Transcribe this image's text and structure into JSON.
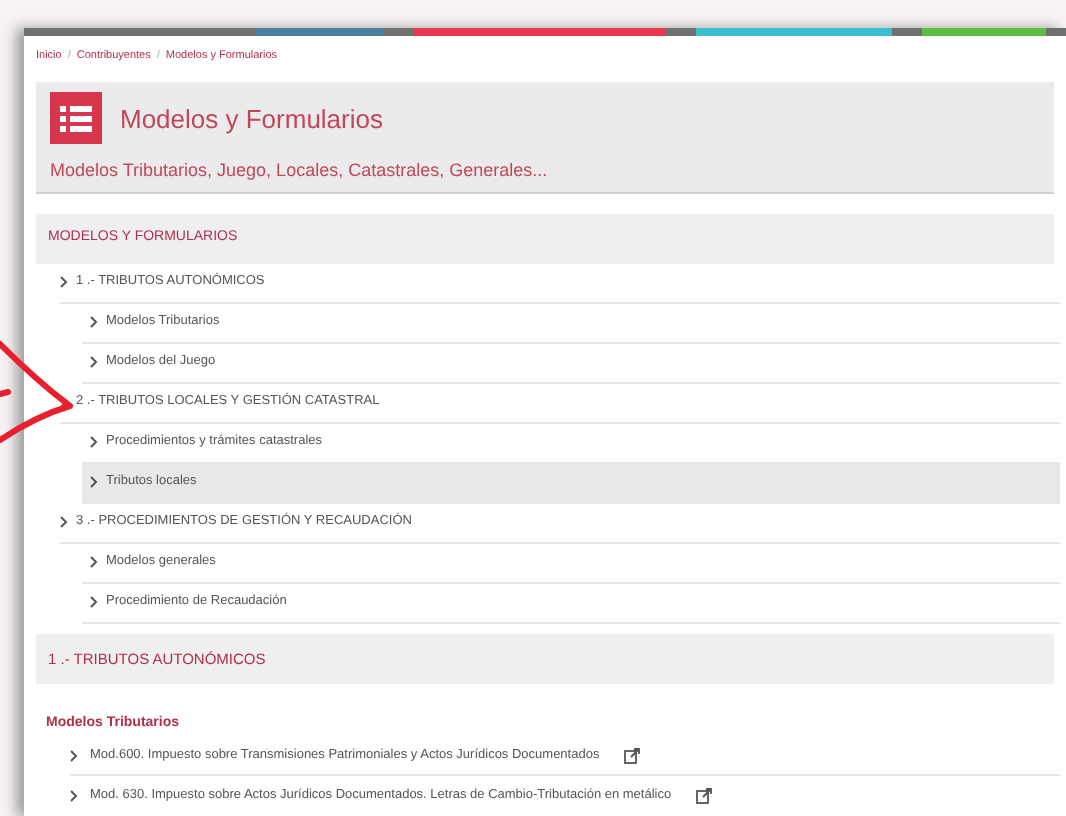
{
  "breadcrumbs": {
    "separator": "/",
    "items": [
      "Inicio",
      "Contribuyentes",
      "Modelos y Formularios"
    ]
  },
  "header": {
    "title": "Modelos y Formularios",
    "subtitle": "Modelos Tributarios, Juego, Locales, Catastrales, Generales..."
  },
  "menu": {
    "title": "MODELOS Y FORMULARIOS",
    "items": [
      {
        "label": "1 .- TRIBUTOS AUTONÓMICOS",
        "selected": false,
        "children": [
          {
            "label": "Modelos Tributarios",
            "selected": false
          },
          {
            "label": "Modelos del Juego",
            "selected": false
          }
        ]
      },
      {
        "label": "2 .- TRIBUTOS LOCALES Y GESTIÓN CATASTRAL",
        "selected": false,
        "children": [
          {
            "label": "Procedimientos y trámites catastrales",
            "selected": false
          },
          {
            "label": "Tributos locales",
            "selected": true
          }
        ]
      },
      {
        "label": "3 .- PROCEDIMIENTOS DE GESTIÓN Y RECAUDACIÓN",
        "selected": false,
        "children": [
          {
            "label": "Modelos generales",
            "selected": false
          },
          {
            "label": "Procedimiento de Recaudación",
            "selected": false
          }
        ]
      }
    ]
  },
  "section": {
    "title": "1 .- TRIBUTOS AUTONÓMICOS",
    "heading": "Modelos Tributarios",
    "links": [
      {
        "label": "Mod.600. Impuesto sobre Transmisiones Patrimoniales y Actos Jurídicos Documentados"
      },
      {
        "label": "Mod. 630. Impuesto sobre Actos Jurídicos Documentados. Letras de Cambio-Tributación en metálico"
      }
    ]
  }
}
